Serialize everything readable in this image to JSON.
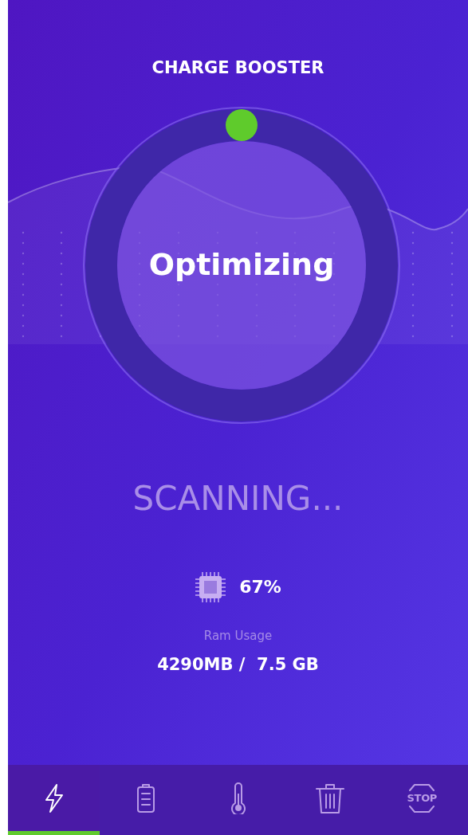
{
  "header": {
    "title": "CHARGE BOOSTER"
  },
  "gauge": {
    "status": "Optimizing"
  },
  "scan_status": "SCANNING...",
  "cpu": {
    "reading": "67%"
  },
  "ram": {
    "label": "Ram Usage",
    "value": "4290MB /  7.5 GB"
  },
  "nav": [
    {
      "kind": "bolt",
      "selected": true
    },
    {
      "kind": "battery",
      "selected": false
    },
    {
      "kind": "thermometer",
      "selected": false
    },
    {
      "kind": "trash",
      "selected": false
    },
    {
      "kind": "stop",
      "label": "STOP",
      "selected": false
    }
  ]
}
